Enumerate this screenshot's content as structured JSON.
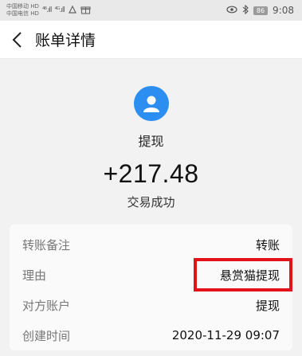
{
  "status_bar": {
    "carrier1": "中国移动 HD",
    "carrier2": "中国电信 HD",
    "signal1": "⁴⁶.ıll",
    "signal2": "⁴ᴳ.ıll",
    "battery": "86",
    "time": "9:08"
  },
  "header": {
    "title": "账单详情"
  },
  "summary": {
    "type": "提现",
    "amount": "+217.48",
    "status": "交易成功"
  },
  "details": {
    "rows": [
      {
        "label": "转账备注",
        "value": "转账"
      },
      {
        "label": "理由",
        "value": "悬赏猫提现"
      },
      {
        "label": "对方账户",
        "value": "提现"
      },
      {
        "label": "创建时间",
        "value": "2020-11-29 09:07"
      }
    ]
  },
  "colors": {
    "avatar_bg": "#2c8ef0",
    "highlight_border": "#e3131b"
  }
}
